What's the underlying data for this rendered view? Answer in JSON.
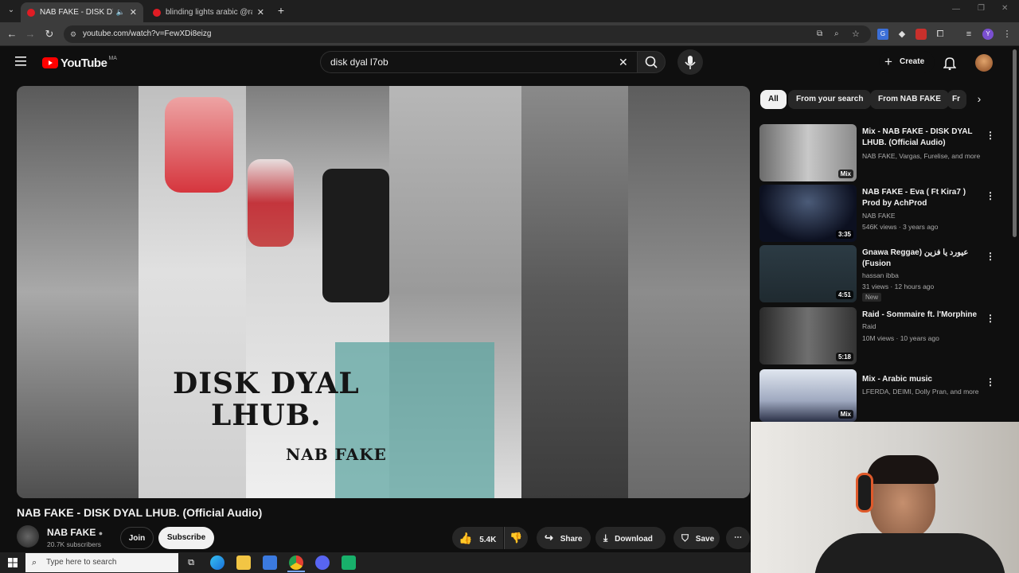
{
  "browser": {
    "tabs": [
      {
        "title": "NAB FAKE - DISK DYAL LHUB.",
        "active": true
      },
      {
        "title": "blinding lights arabic @rachide",
        "active": false
      }
    ],
    "url": "youtube.com/watch?v=FewXDi8eizg"
  },
  "header": {
    "logo_text": "YouTube",
    "country": "MA",
    "search_value": "disk dyal l7ob",
    "create_label": "Create"
  },
  "video": {
    "cover_title_line1": "DISK DYAL",
    "cover_title_line2": "LHUB.",
    "cover_artist": "NAB FAKE",
    "title": "NAB FAKE - DISK DYAL LHUB. (Official Audio)",
    "channel": "NAB FAKE",
    "subscribers": "20.7K subscribers",
    "join_label": "Join",
    "subscribe_label": "Subscribe",
    "likes": "5.4K",
    "share_label": "Share",
    "download_label": "Download",
    "save_label": "Save"
  },
  "chips": [
    "All",
    "From your search",
    "From NAB FAKE",
    "Fr"
  ],
  "recommendations": [
    {
      "title": "Mix - NAB FAKE - DISK DYAL LHUB. (Official Audio)",
      "line1": "NAB FAKE, Vargas, Furelise, and more",
      "line2": "",
      "badge": "Mix",
      "new": ""
    },
    {
      "title": "NAB FAKE - Eva ( Ft Kira7 ) Prod by AchProd",
      "line1": "NAB FAKE",
      "line2": "546K views · 3 years ago",
      "badge": "3:35",
      "new": ""
    },
    {
      "title": "Gnawa Reggae) عيورد يا فزين (Fusion",
      "line1": "hassan ibba",
      "line2": "31 views · 12 hours ago",
      "badge": "4:51",
      "new": "New"
    },
    {
      "title": "Raid - Sommaire ft. l'Morphine",
      "line1": "Raid",
      "line2": "10M views · 10 years ago",
      "badge": "5:18",
      "new": ""
    },
    {
      "title": "Mix - Arabic music",
      "line1": "LFERDA, DEIMI, Dolly Pran, and more",
      "line2": "",
      "badge": "Mix",
      "new": ""
    }
  ],
  "taskbar": {
    "search_placeholder": "Type here to search"
  },
  "colors": {
    "brand_red": "#ff0000",
    "background": "#0f0f0f",
    "chip_bg": "#272727"
  }
}
